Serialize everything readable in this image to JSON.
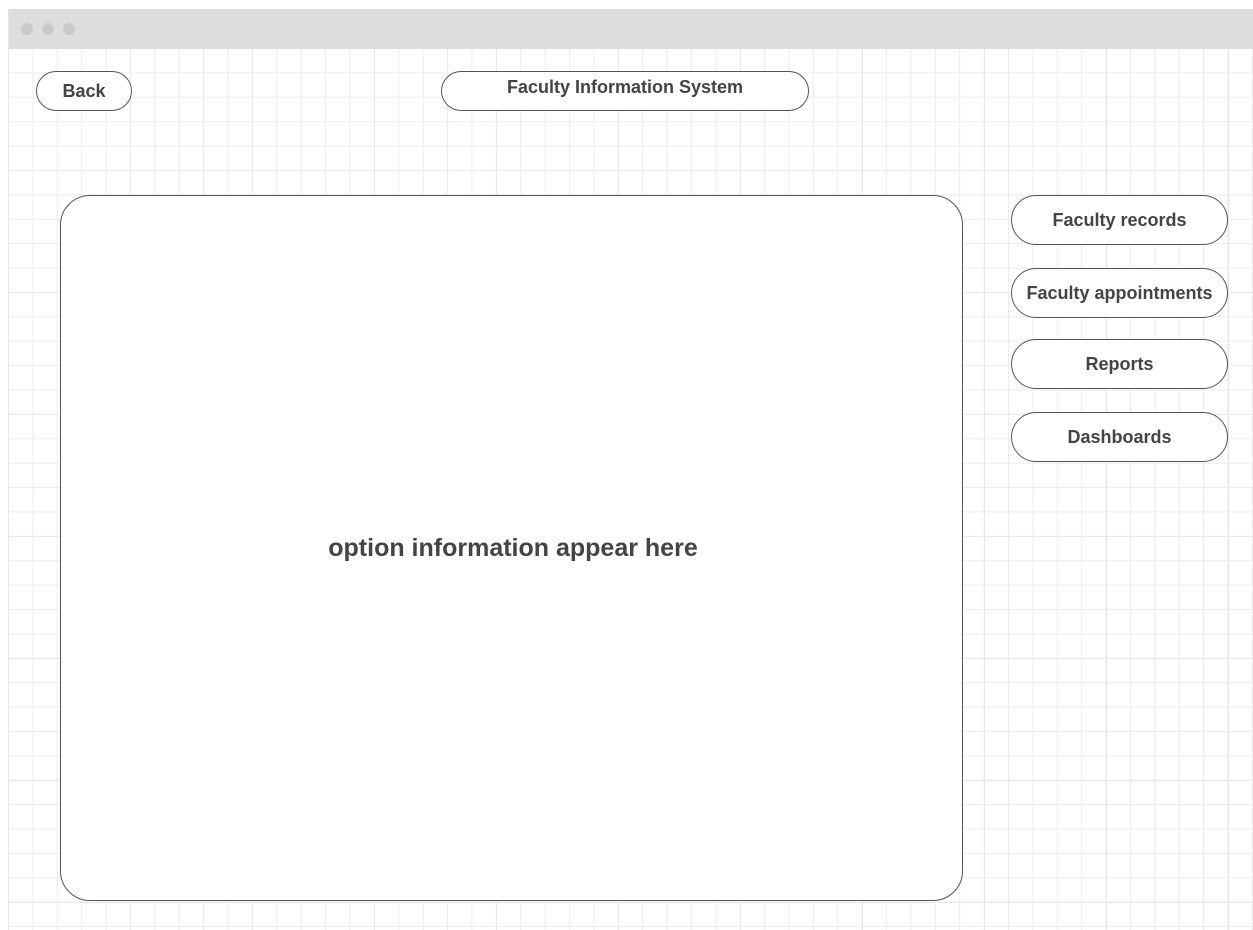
{
  "app": {
    "title": "Faculty Information System"
  },
  "header": {
    "back_label": "Back"
  },
  "main": {
    "placeholder_text": "option information appear here"
  },
  "nav": {
    "items": [
      {
        "label": "Faculty records"
      },
      {
        "label": "Faculty appointments"
      },
      {
        "label": "Reports"
      },
      {
        "label": "Dashboards"
      }
    ]
  },
  "colors": {
    "titlebar": "#dddddd",
    "window_dot": "#c9c9c9",
    "border": "#555555",
    "text": "#444444",
    "grid": "#ececec"
  }
}
